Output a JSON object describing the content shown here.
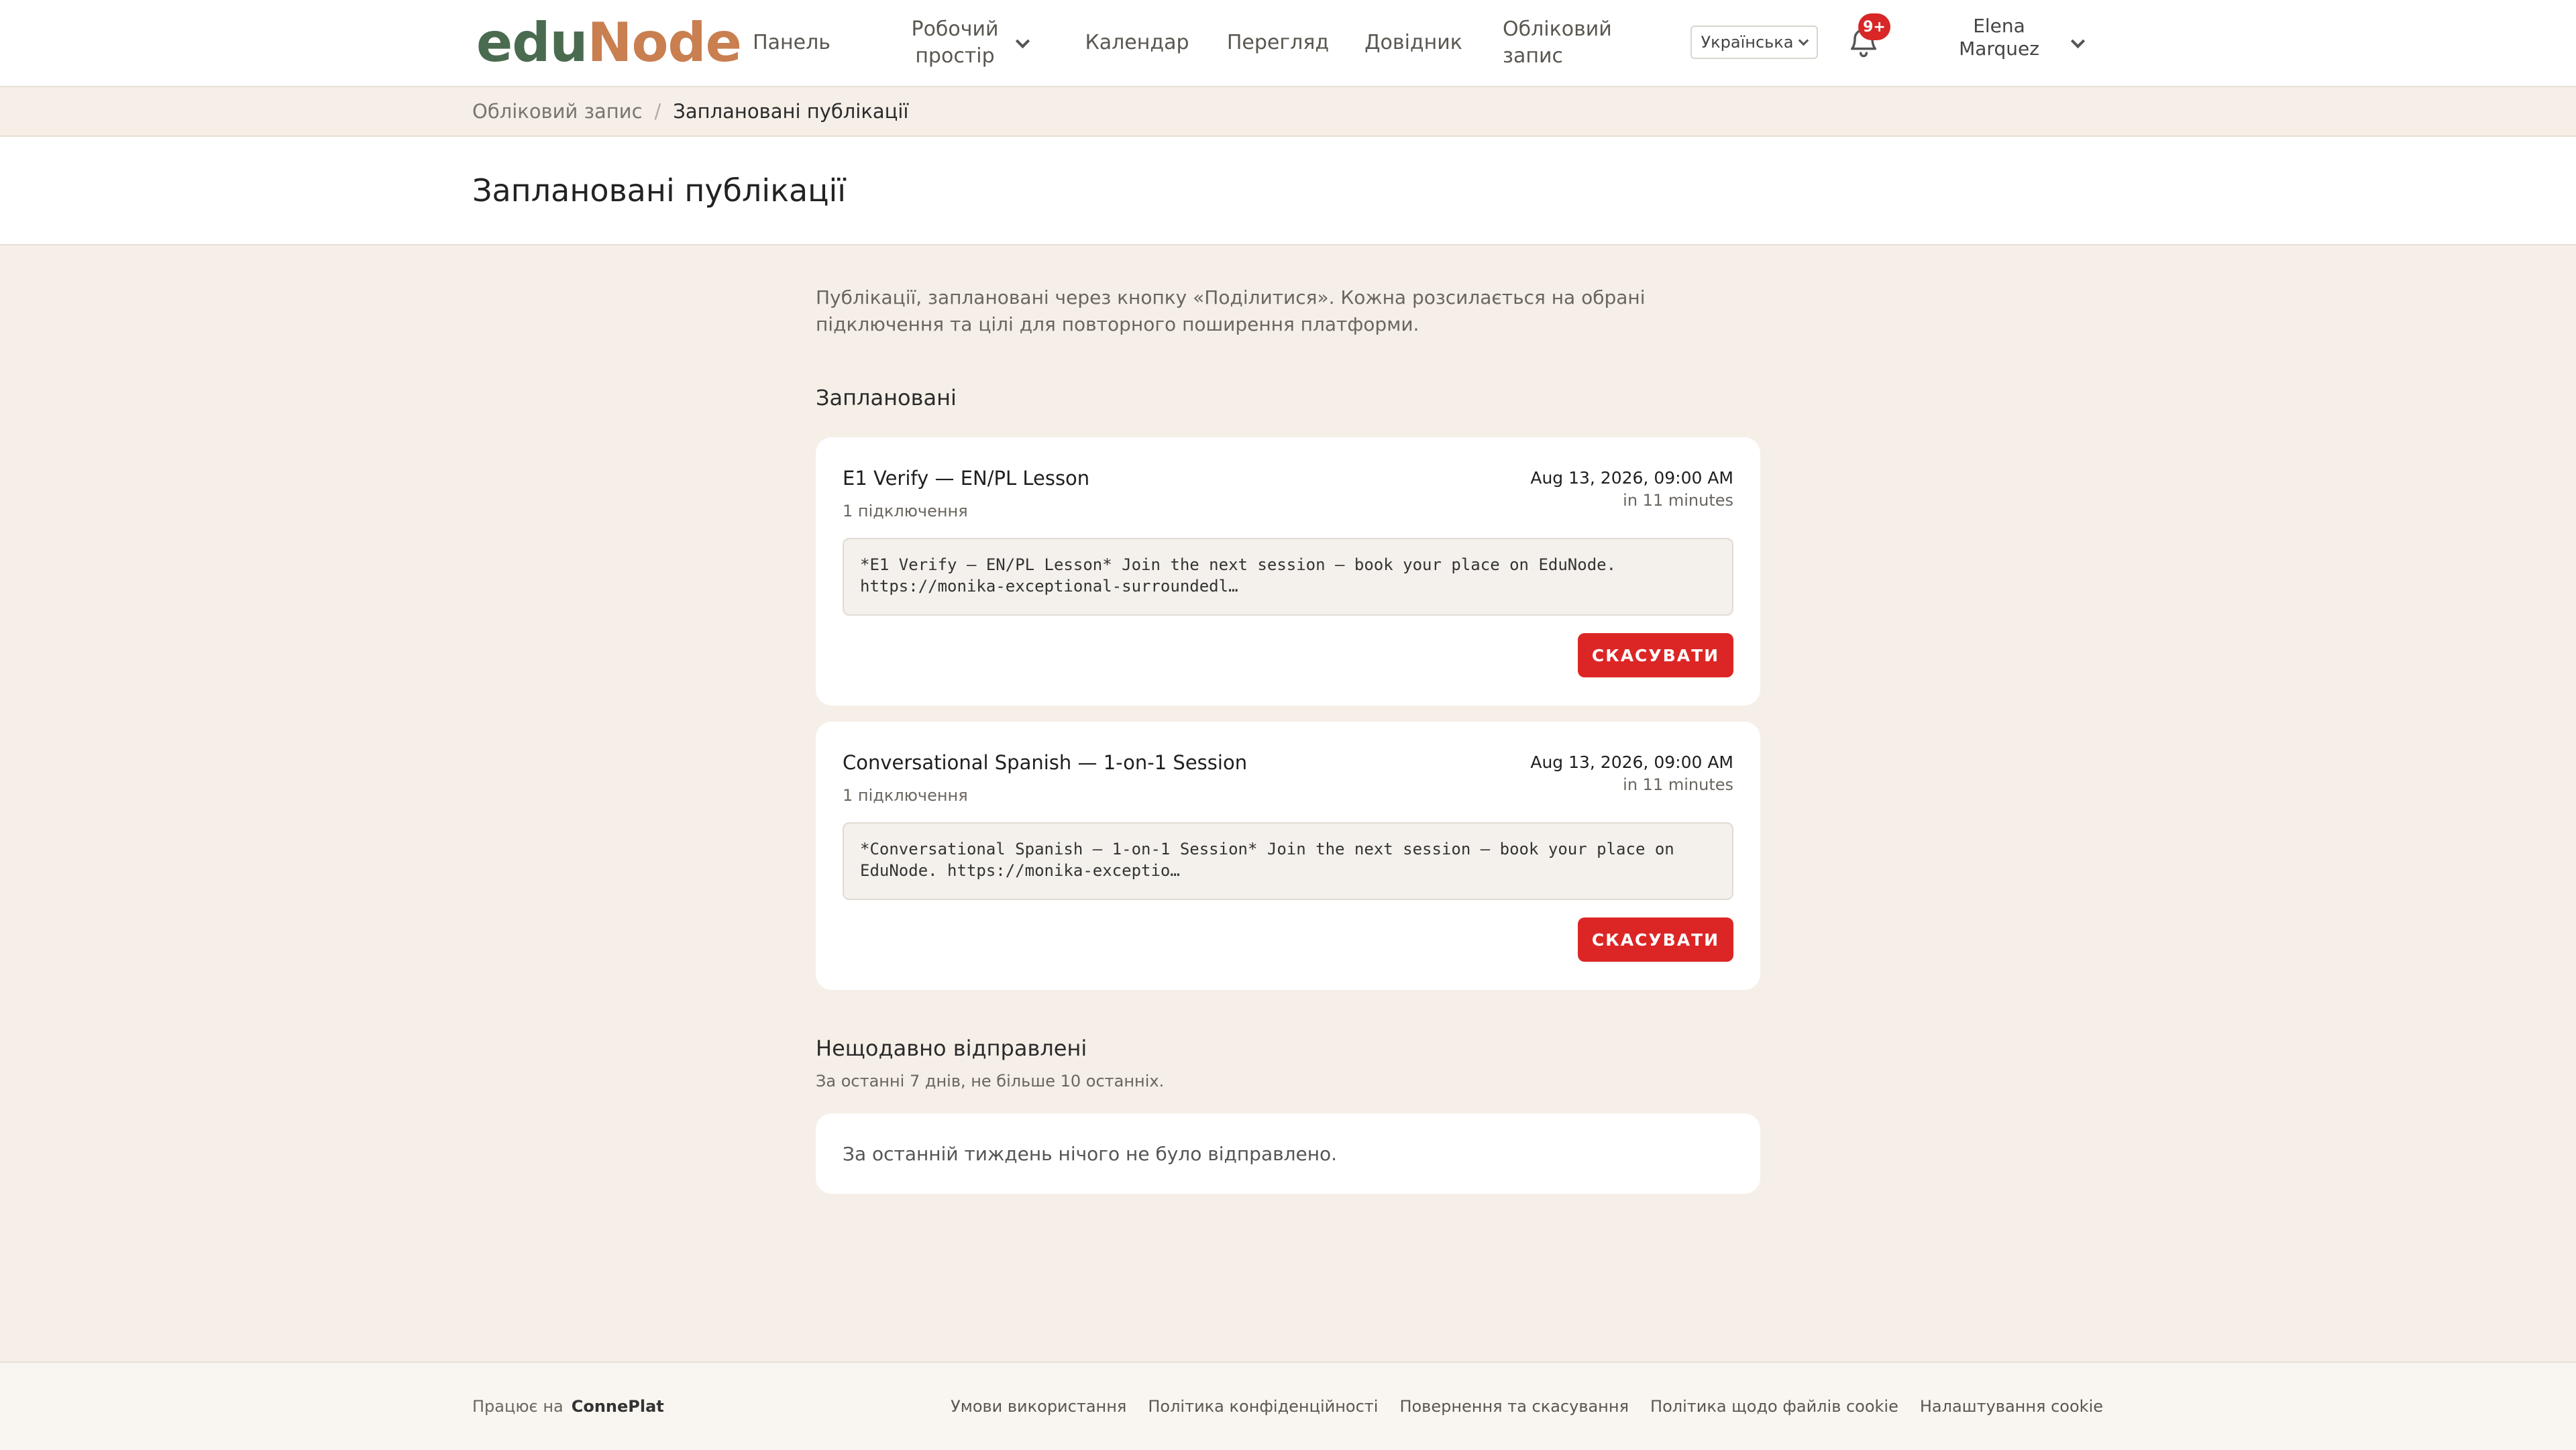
{
  "header": {
    "logo_part1": "edu",
    "logo_part2": "Node",
    "nav": {
      "dashboard": "Панель",
      "workspace_line1": "Робочий",
      "workspace_line2": "простір",
      "calendar": "Календар",
      "browse": "Перегляд",
      "help": "Довідник",
      "account_line1": "Обліковий",
      "account_line2": "запис"
    },
    "language": "Українська",
    "notifications_badge": "9+",
    "user_first": "Elena",
    "user_last": "Marquez"
  },
  "breadcrumb": {
    "parent": "Обліковий запис",
    "separator": "/",
    "current": "Заплановані публікації"
  },
  "page_title": "Заплановані публікації",
  "intro_text": "Публікації, заплановані через кнопку «Поділитися». Кожна розсилається на обрані підключення та цілі для повторного поширення платформи.",
  "scheduled": {
    "title": "Заплановані",
    "cards": [
      {
        "title": "E1 Verify — EN/PL Lesson",
        "connections": "1 підключення",
        "date": "Aug 13, 2026, 09:00 AM",
        "relative": "in 11 minutes",
        "message": "*E1 Verify — EN/PL Lesson* Join the next session — book your place on EduNode. https://monika-exceptional-surroundedl…",
        "cancel_label": "СКАСУВАТИ"
      },
      {
        "title": "Conversational Spanish — 1-on-1 Session",
        "connections": "1 підключення",
        "date": "Aug 13, 2026, 09:00 AM",
        "relative": "in 11 minutes",
        "message": "*Conversational Spanish — 1-on-1 Session* Join the next session — book your place on EduNode. https://monika-exceptio…",
        "cancel_label": "СКАСУВАТИ"
      }
    ]
  },
  "recent": {
    "title": "Нещодавно відправлені",
    "subtitle": "За останні 7 днів, не більше 10 останніх.",
    "empty_text": "За останній тиждень нічого не було відправлено."
  },
  "footer": {
    "powered_label": "Працює на",
    "powered_brand": "ConnePlat",
    "links": {
      "terms": "Умови використання",
      "privacy": "Політика конфіденційності",
      "refunds": "Повернення та скасування",
      "cookie_policy": "Політика щодо файлів cookie",
      "cookie_settings": "Налаштування cookie"
    }
  },
  "colors": {
    "background": "#f5efe8",
    "logo_green": "#4a6b4f",
    "logo_orange": "#c97f50",
    "danger": "#dc2626"
  }
}
